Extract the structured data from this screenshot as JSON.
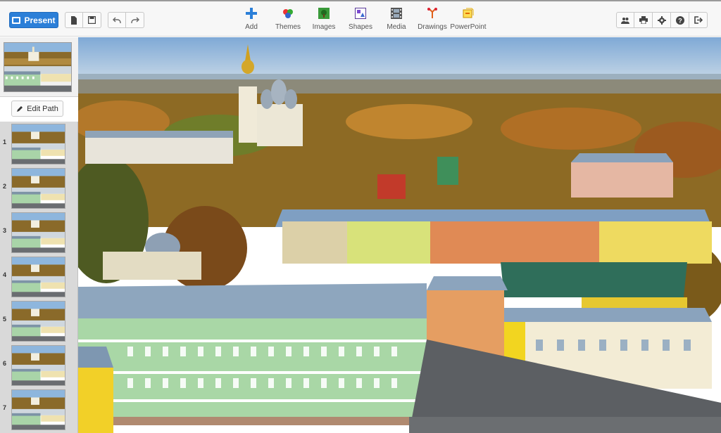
{
  "toolbar": {
    "present_label": "Present",
    "tools": [
      {
        "label": "Add",
        "icon": "plus-icon"
      },
      {
        "label": "Themes",
        "icon": "palette-icon"
      },
      {
        "label": "Images",
        "icon": "image-icon"
      },
      {
        "label": "Shapes",
        "icon": "shapes-icon"
      },
      {
        "label": "Media",
        "icon": "film-icon"
      },
      {
        "label": "Drawings",
        "icon": "drawing-icon"
      },
      {
        "label": "PowerPoint",
        "icon": "powerpoint-icon"
      }
    ],
    "left_icons": [
      "new-file-icon",
      "save-icon",
      "undo-icon",
      "redo-icon"
    ],
    "right_icons": [
      "users-icon",
      "print-icon",
      "settings-icon",
      "help-icon",
      "sign-out-icon"
    ]
  },
  "sidebar": {
    "edit_path_label": "Edit Path",
    "slides": [
      {
        "number": "1"
      },
      {
        "number": "2"
      },
      {
        "number": "3"
      },
      {
        "number": "4"
      },
      {
        "number": "5"
      },
      {
        "number": "6"
      },
      {
        "number": "7"
      }
    ]
  },
  "colors": {
    "accent": "#2b7fd8",
    "add_icon": "#2b7fd8",
    "images_icon": "#3a9a3a",
    "drawings_icon": "#e0601a",
    "powerpoint_icon": "#e8b000"
  }
}
